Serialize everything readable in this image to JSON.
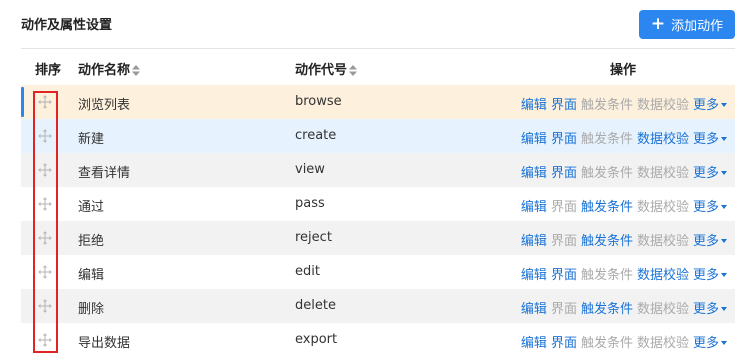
{
  "header": {
    "title": "动作及属性设置",
    "add_button_icon": "+",
    "add_button_label": "添加动作"
  },
  "columns": {
    "sort": "排序",
    "name": "动作名称",
    "code": "动作代号",
    "ops": "操作"
  },
  "op_labels": {
    "edit": "编辑",
    "ui": "界面",
    "trigger": "触发条件",
    "validate": "数据校验",
    "more": "更多"
  },
  "rows": [
    {
      "name": "浏览列表",
      "code": "browse",
      "state": "active",
      "ops": {
        "edit": true,
        "ui": true,
        "trigger": false,
        "validate": false
      }
    },
    {
      "name": "新建",
      "code": "create",
      "state": "hover",
      "ops": {
        "edit": true,
        "ui": true,
        "trigger": false,
        "validate": true
      }
    },
    {
      "name": "查看详情",
      "code": "view",
      "state": "even",
      "ops": {
        "edit": true,
        "ui": true,
        "trigger": false,
        "validate": false
      }
    },
    {
      "name": "通过",
      "code": "pass",
      "state": "odd",
      "ops": {
        "edit": true,
        "ui": false,
        "trigger": true,
        "validate": false
      }
    },
    {
      "name": "拒绝",
      "code": "reject",
      "state": "even",
      "ops": {
        "edit": true,
        "ui": false,
        "trigger": true,
        "validate": false
      }
    },
    {
      "name": "编辑",
      "code": "edit",
      "state": "odd",
      "ops": {
        "edit": true,
        "ui": true,
        "trigger": false,
        "validate": true
      }
    },
    {
      "name": "删除",
      "code": "delete",
      "state": "even",
      "ops": {
        "edit": true,
        "ui": false,
        "trigger": true,
        "validate": false
      }
    },
    {
      "name": "导出数据",
      "code": "export",
      "state": "odd",
      "ops": {
        "edit": true,
        "ui": true,
        "trigger": false,
        "validate": false
      }
    }
  ],
  "colors": {
    "accent": "#2b86f0",
    "link": "#1a73d6",
    "disabled": "#aaaaaa",
    "active_row": "#fdf0dd",
    "hover_row": "#e6f2fd",
    "highlight_box": "#e02424"
  }
}
